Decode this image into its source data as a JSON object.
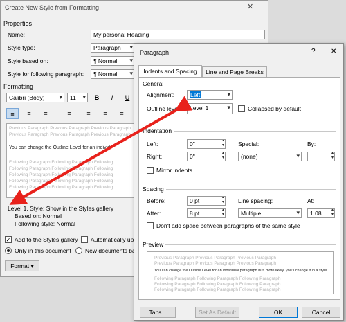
{
  "back_dialog": {
    "title": "Create New Style from Formatting",
    "properties_header": "Properties",
    "name_label": "Name:",
    "name_value": "My personal Heading",
    "style_type_label": "Style type:",
    "style_type_value": "Paragraph",
    "based_on_label": "Style based on:",
    "based_on_value": "¶  Normal",
    "following_label": "Style for following paragraph:",
    "following_value": "¶  Normal",
    "formatting_header": "Formatting",
    "font_value": "Calibri (Body)",
    "size_value": "11",
    "bold": "B",
    "italic": "I",
    "preview_prev": "Previous Paragraph Previous Paragraph Previous Paragraph",
    "preview_text": "You can change the Outline Level for an individ",
    "preview_follow": "Following Paragraph Following Paragraph Following",
    "desc_line1": "Level 1, Style: Show in the Styles gallery",
    "desc_line2": "Based on: Normal",
    "desc_line3": "Following style: Normal",
    "add_gallery": "Add to the Styles gallery",
    "auto_update": "Automatically up",
    "only_doc": "Only in this document",
    "new_docs": "New documents ba",
    "format_btn": "Format ▾"
  },
  "dialog": {
    "title": "Paragraph",
    "help": "?",
    "close": "✕",
    "tabs": [
      "Indents and Spacing",
      "Line and Page Breaks"
    ],
    "general_label": "General",
    "alignment_label": "Alignment:",
    "alignment_value": "Left",
    "outline_label": "Outline level:",
    "outline_value": "Level 1",
    "collapsed_label": "Collapsed by default",
    "indentation_label": "Indentation",
    "left_label": "Left:",
    "left_value": "0\"",
    "right_label": "Right:",
    "right_value": "0\"",
    "special_label": "Special:",
    "special_value": "(none)",
    "by_label": "By:",
    "mirror_label": "Mirror indents",
    "spacing_label": "Spacing",
    "before_label": "Before:",
    "before_value": "0 pt",
    "after_label": "After:",
    "after_value": "8 pt",
    "line_spacing_label": "Line spacing:",
    "line_spacing_value": "Multiple",
    "at_label": "At:",
    "at_value": "1.08",
    "dont_add_label": "Don't add space between paragraphs of the same style",
    "preview_label": "Preview",
    "preview_prev": "Previous Paragraph Previous Paragraph Previous Paragraph",
    "preview_text": "You can change the Outline Level for an individual paragraph but, more likely, you'll change it in a style.",
    "preview_follow": "Following Paragraph Following Paragraph Following Paragraph",
    "tabs_btn": "Tabs...",
    "default_btn": "Set As Default",
    "ok_btn": "OK",
    "cancel_btn": "Cancel"
  },
  "colors": {
    "arrow": "#e8211b",
    "highlight": "#0078d7"
  }
}
